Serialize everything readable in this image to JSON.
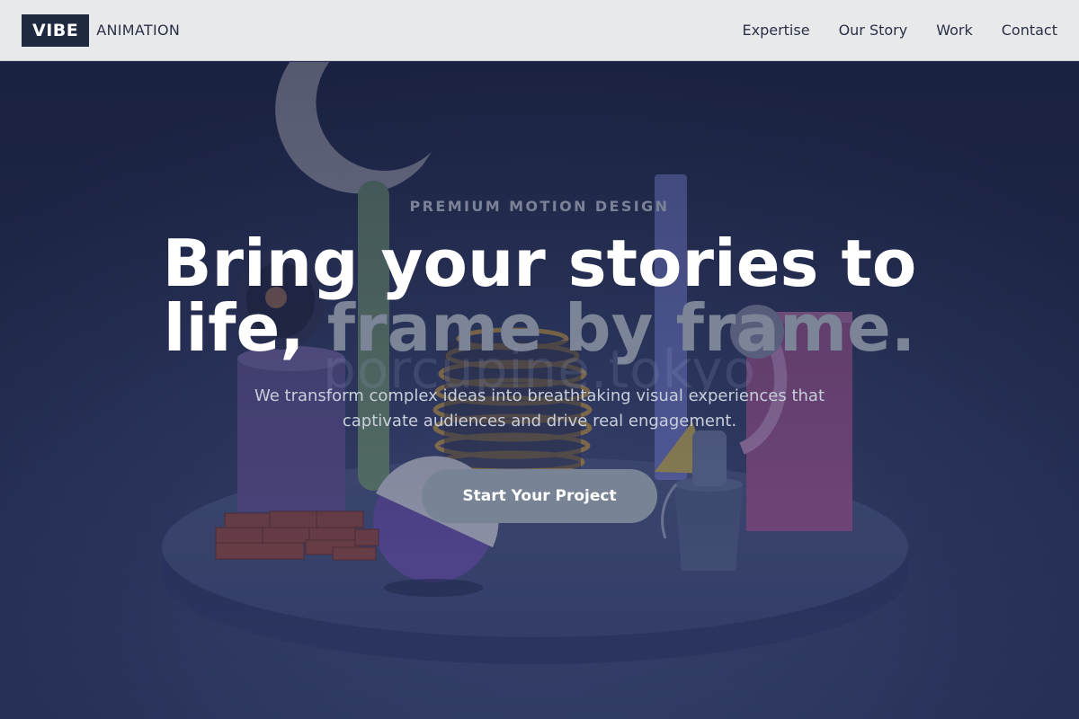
{
  "header": {
    "logo_box": "VIBE",
    "logo_word": "ANIMATION",
    "nav": [
      "Expertise",
      "Our Story",
      "Work",
      "Contact"
    ]
  },
  "hero": {
    "eyebrow": "PREMIUM MOTION DESIGN",
    "headline_line1": "Bring your stories to",
    "headline_line2_strong": "life,",
    "headline_line2_muted": "frame by frame.",
    "watermark": "porcupine.tokyo",
    "subtext_line1": "We transform complex ideas into breathtaking visual experiences that",
    "subtext_line2": "captivate audiences and drive real engagement.",
    "cta_label": "Start Your Project"
  },
  "colors": {
    "header_bg": "#e8e9eb",
    "logo_bg": "#1f2940",
    "hero_bg": "#222b4a",
    "cta_bg": "#788496",
    "muted_text": "#7c8497"
  },
  "icons": [
    "cup-shape",
    "pillar-shape",
    "ball-shape",
    "bucket-shape",
    "brick-pile-shape",
    "coil-stack-shape"
  ]
}
